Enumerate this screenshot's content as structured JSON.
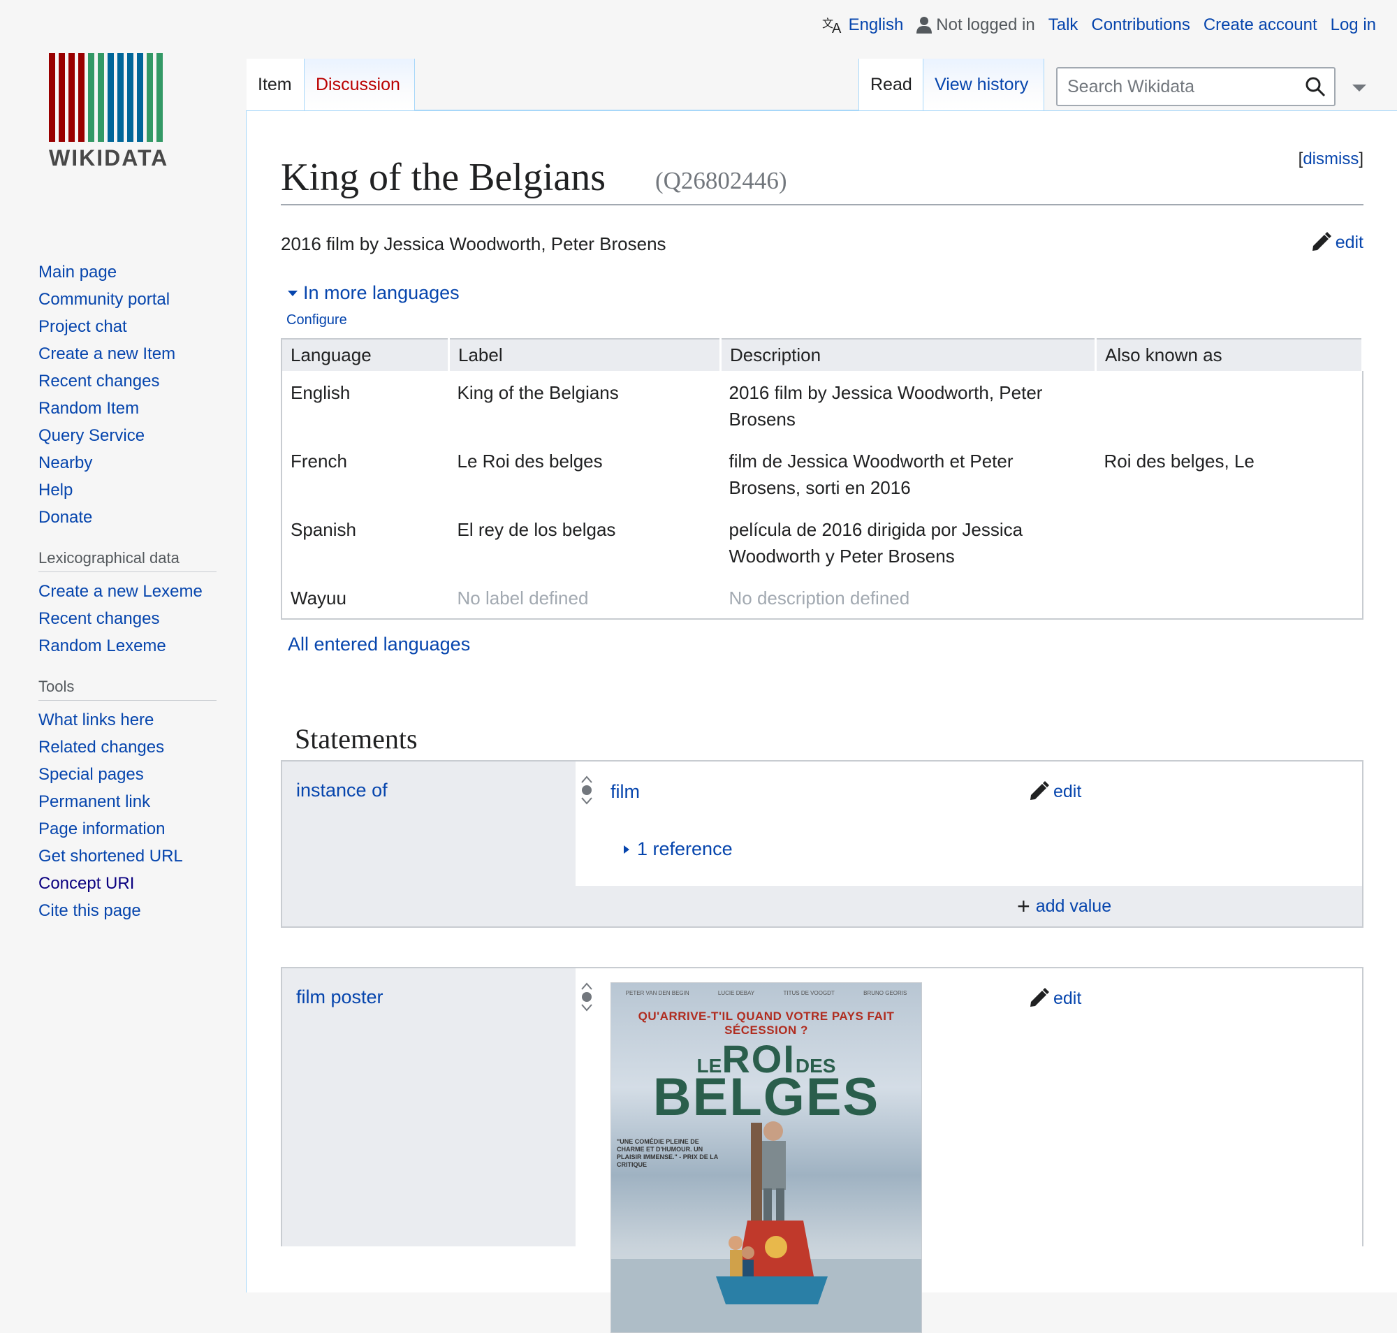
{
  "personal": {
    "language": "English",
    "not_logged_in": "Not logged in",
    "talk": "Talk",
    "contributions": "Contributions",
    "create_account": "Create account",
    "log_in": "Log in"
  },
  "logo": {
    "wordmark": "WIKIDATA",
    "bar_colors": [
      "#990000",
      "#990000",
      "#990000",
      "#990000",
      "#339966",
      "#339966",
      "#006699",
      "#006699",
      "#006699",
      "#006699",
      "#339966",
      "#339966"
    ]
  },
  "sidebar": {
    "navigation": [
      "Main page",
      "Community portal",
      "Project chat",
      "Create a new Item",
      "Recent changes",
      "Random Item",
      "Query Service",
      "Nearby",
      "Help",
      "Donate"
    ],
    "lexico_heading": "Lexicographical data",
    "lexico": [
      "Create a new Lexeme",
      "Recent changes",
      "Random Lexeme"
    ],
    "tools_heading": "Tools",
    "tools": [
      "What links here",
      "Related changes",
      "Special pages",
      "Permanent link",
      "Page information",
      "Get shortened URL",
      "Concept URI",
      "Cite this page"
    ]
  },
  "tabs": {
    "item": "Item",
    "discussion": "Discussion",
    "read": "Read",
    "view_history": "View history"
  },
  "search": {
    "placeholder": "Search Wikidata"
  },
  "page": {
    "title": "King of the Belgians",
    "qid": "(Q26802446)",
    "dismiss": "dismiss",
    "description": "2016 film by Jessica Woodworth, Peter Brosens",
    "edit": "edit"
  },
  "languages": {
    "toggle": "In more languages",
    "configure": "Configure",
    "headers": [
      "Language",
      "Label",
      "Description",
      "Also known as"
    ],
    "rows": [
      {
        "language": "English",
        "label": "King of the Belgians",
        "description": "2016 film by Jessica Woodworth, Peter Brosens",
        "aliases": ""
      },
      {
        "language": "French",
        "label": "Le Roi des belges",
        "description": "film de Jessica Woodworth et Peter Brosens, sorti en 2016",
        "aliases": "Roi des belges, Le"
      },
      {
        "language": "Spanish",
        "label": "El rey de los belgas",
        "description": "película de 2016 dirigida por Jessica Woodworth y Peter Brosens",
        "aliases": ""
      },
      {
        "language": "Wayuu",
        "label": "No label defined",
        "description": "No description defined",
        "aliases": ""
      }
    ],
    "all_entered": "All entered languages"
  },
  "statements": {
    "heading": "Statements",
    "groups": [
      {
        "property": "instance of",
        "value": "film",
        "edit": "edit",
        "references": "1 reference",
        "add_value": "add value"
      },
      {
        "property": "film poster",
        "edit": "edit"
      }
    ]
  },
  "poster": {
    "credits": [
      "PETER VAN DEN BEGIN",
      "LUCIE DEBAY",
      "TITUS DE VOOGDT",
      "BRUNO GEORIS"
    ],
    "tagline": "QU'ARRIVE-T'IL QUAND VOTRE PAYS FAIT SÉCESSION ?",
    "title_le": "LE",
    "title_roi": "ROI",
    "title_des": "DES",
    "title_belges": "BELGES",
    "quote": "\"UNE COMÉDIE PLEINE DE CHARME ET D'HUMOUR. UN PLAISIR IMMENSE.\" - PRIX DE LA CRITIQUE"
  }
}
